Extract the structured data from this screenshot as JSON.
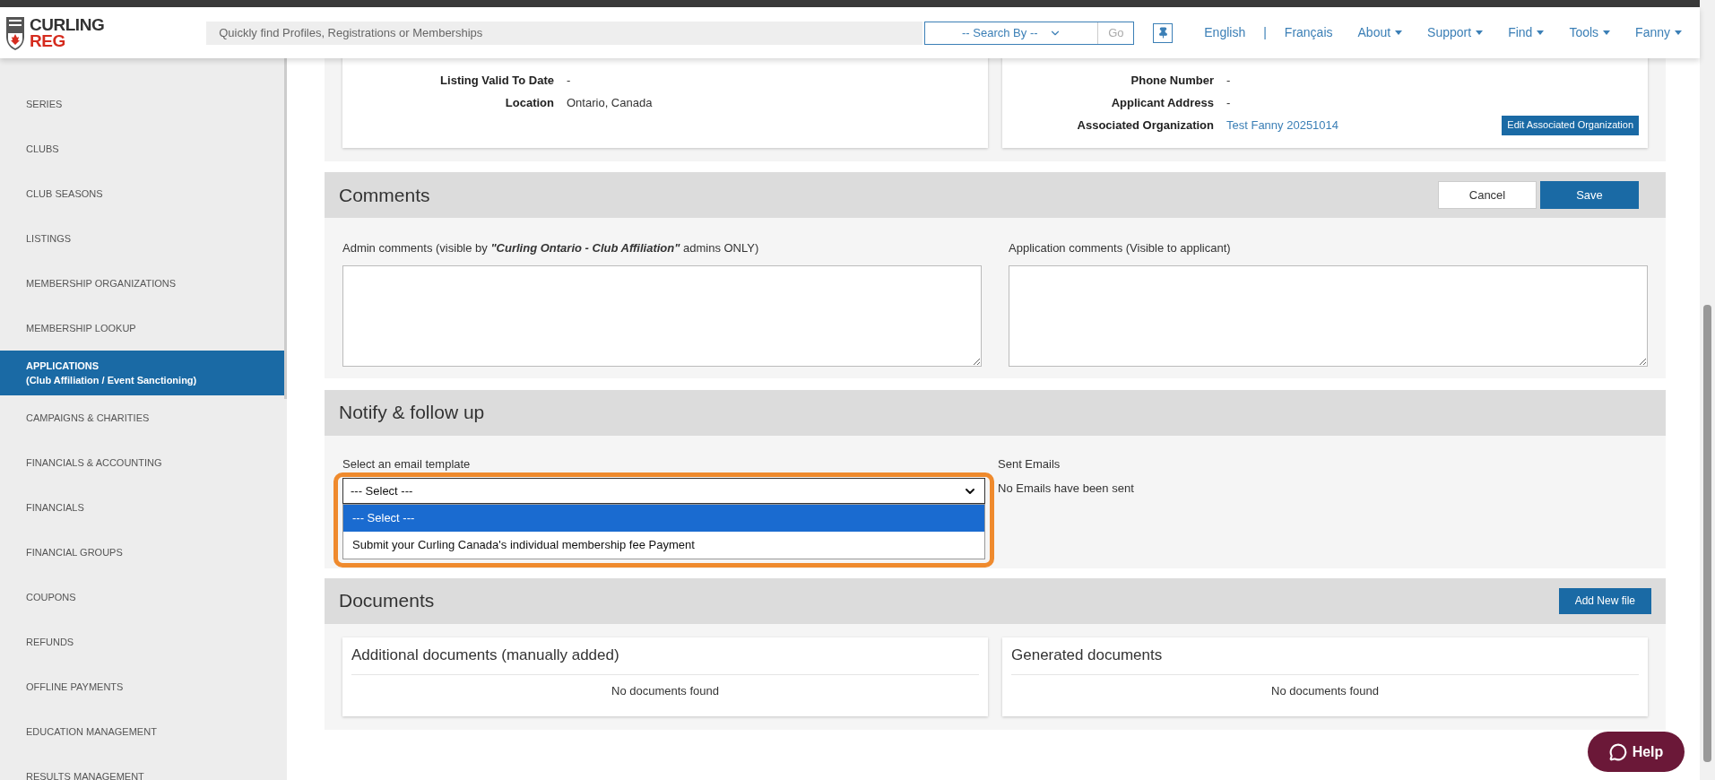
{
  "header": {
    "logo": {
      "line1": "CURLING",
      "line2": "REG"
    },
    "search": {
      "placeholder": "Quickly find Profiles, Registrations or Memberships"
    },
    "search_by": "-- Search By --",
    "go": "Go",
    "nav": [
      {
        "label": "English",
        "dropdown": false
      },
      {
        "label": "|",
        "kind": "separator"
      },
      {
        "label": "Français",
        "dropdown": false
      },
      {
        "label": "About",
        "dropdown": true
      },
      {
        "label": "Support",
        "dropdown": true
      },
      {
        "label": "Find",
        "dropdown": true
      },
      {
        "label": "Tools",
        "dropdown": true
      },
      {
        "label": "Fanny",
        "dropdown": true
      }
    ]
  },
  "sidebar": {
    "items": [
      {
        "label": "SERIES",
        "selected": false
      },
      {
        "label": "CLUBS",
        "selected": false
      },
      {
        "label": "CLUB SEASONS",
        "selected": false
      },
      {
        "label": "LISTINGS",
        "selected": false
      },
      {
        "label": "MEMBERSHIP ORGANIZATIONS",
        "selected": false
      },
      {
        "label": "MEMBERSHIP LOOKUP",
        "selected": false
      },
      {
        "label": "APPLICATIONS",
        "sublabel": "(Club Affiliation / Event Sanctioning)",
        "selected": true
      },
      {
        "label": "CAMPAIGNS & CHARITIES",
        "selected": false
      },
      {
        "label": "FINANCIALS & ACCOUNTING",
        "selected": false
      },
      {
        "label": "FINANCIALS",
        "selected": false
      },
      {
        "label": "FINANCIAL GROUPS",
        "selected": false
      },
      {
        "label": "COUPONS",
        "selected": false
      },
      {
        "label": "REFUNDS",
        "selected": false
      },
      {
        "label": "OFFLINE PAYMENTS",
        "selected": false
      },
      {
        "label": "EDUCATION MANAGEMENT",
        "selected": false
      },
      {
        "label": "RESULTS MANAGEMENT",
        "selected": false
      }
    ]
  },
  "details": {
    "left": [
      {
        "label": "Listing Valid To Date",
        "value": "-"
      },
      {
        "label": "Location",
        "value": "Ontario, Canada"
      }
    ],
    "right": [
      {
        "label": "Phone Number",
        "value": "-"
      },
      {
        "label": "Applicant Address",
        "value": "-"
      },
      {
        "label": "Associated Organization",
        "link": "Test Fanny 20251014",
        "button": "Edit Associated Organization"
      }
    ]
  },
  "comments": {
    "title": "Comments",
    "cancel": "Cancel",
    "save": "Save",
    "fields": [
      {
        "before": "Admin comments (visible by ",
        "emphasis": "\"Curling Ontario - Club Affiliation\"",
        "after": " admins ONLY)"
      },
      {
        "before": "Application comments (Visible to applicant)"
      }
    ]
  },
  "notify": {
    "title": "Notify & follow up",
    "template_label": "Select an email template",
    "select_value": "--- Select ---",
    "options": [
      {
        "label": "--- Select ---",
        "selected": true
      },
      {
        "label": "Submit your Curling Canada's individual membership fee Payment",
        "selected": false
      }
    ],
    "sent_label": "Sent Emails",
    "sent_text": "No Emails have been sent"
  },
  "documents": {
    "title": "Documents",
    "add_button": "Add New file",
    "cards": [
      {
        "title": "Additional documents (manually added)",
        "empty": "No documents found"
      },
      {
        "title": "Generated documents",
        "empty": "No documents found"
      }
    ]
  },
  "help": "Help"
}
